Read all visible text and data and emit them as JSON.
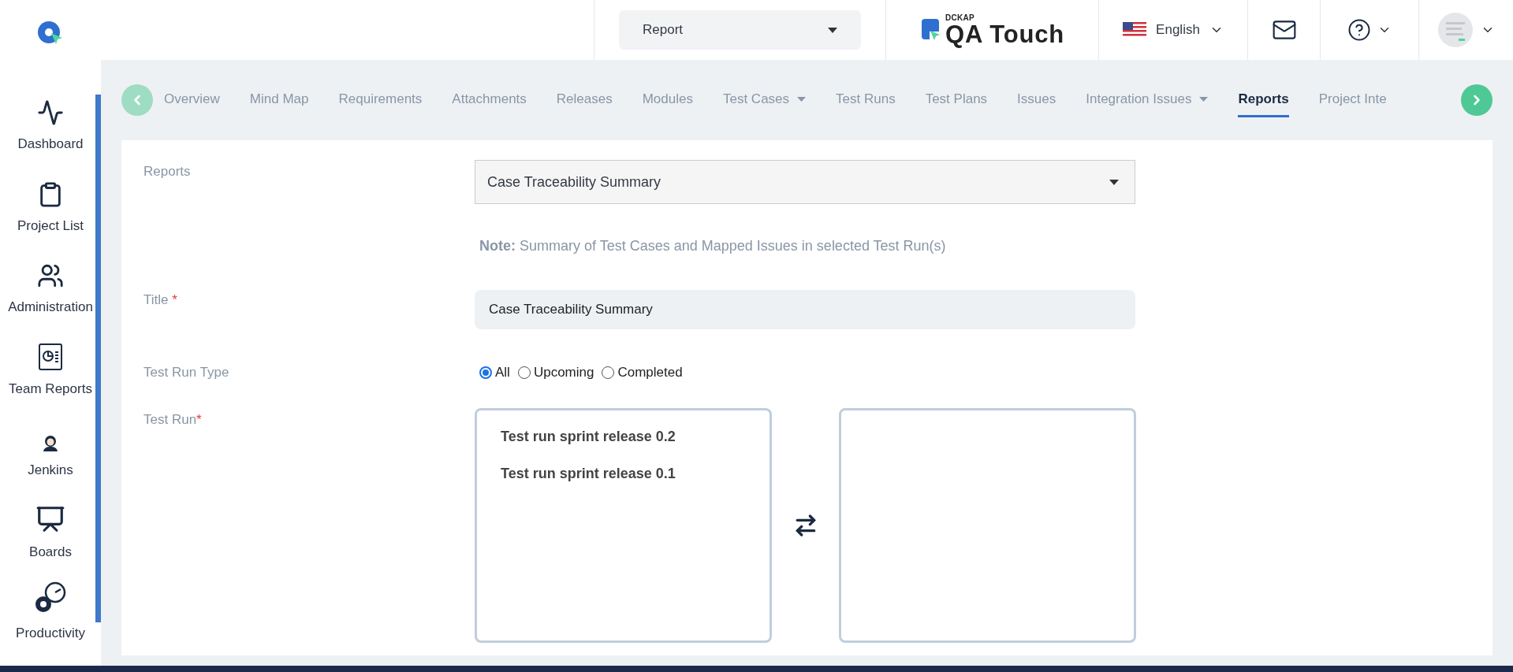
{
  "header": {
    "project_select": {
      "value": "Report"
    },
    "brand": {
      "maker": "DCKAP",
      "name": "QA Touch"
    },
    "language": "English"
  },
  "sidebar": {
    "items": [
      {
        "label": "Dashboard"
      },
      {
        "label": "Project List"
      },
      {
        "label": "Administration"
      },
      {
        "label": "Team Reports"
      },
      {
        "label": "Jenkins"
      },
      {
        "label": "Boards"
      },
      {
        "label": "Productivity"
      }
    ]
  },
  "tabs": [
    {
      "label": "Overview",
      "selected": false,
      "dropdown": false
    },
    {
      "label": "Mind Map",
      "selected": false,
      "dropdown": false
    },
    {
      "label": "Requirements",
      "selected": false,
      "dropdown": false
    },
    {
      "label": "Attachments",
      "selected": false,
      "dropdown": false
    },
    {
      "label": "Releases",
      "selected": false,
      "dropdown": false
    },
    {
      "label": "Modules",
      "selected": false,
      "dropdown": false
    },
    {
      "label": "Test Cases",
      "selected": false,
      "dropdown": true
    },
    {
      "label": "Test Runs",
      "selected": false,
      "dropdown": false
    },
    {
      "label": "Test Plans",
      "selected": false,
      "dropdown": false
    },
    {
      "label": "Issues",
      "selected": false,
      "dropdown": false
    },
    {
      "label": "Integration Issues",
      "selected": false,
      "dropdown": true
    },
    {
      "label": "Reports",
      "selected": true,
      "dropdown": false
    },
    {
      "label": "Project Inte",
      "selected": false,
      "dropdown": false
    }
  ],
  "form": {
    "reports": {
      "label": "Reports",
      "value": "Case Traceability Summary"
    },
    "note": {
      "label": "Note:",
      "text": "Summary of Test Cases and Mapped Issues in selected Test Run(s)"
    },
    "title": {
      "label": "Title",
      "required_mark": "*",
      "value": "Case Traceability Summary"
    },
    "run_type": {
      "label": "Test Run Type",
      "options": [
        {
          "label": "All",
          "selected": true
        },
        {
          "label": "Upcoming",
          "selected": false
        },
        {
          "label": "Completed",
          "selected": false
        }
      ]
    },
    "test_run": {
      "label": "Test Run",
      "required_mark": "*",
      "available": [
        "Test run sprint release 0.2",
        "Test run sprint release 0.1"
      ]
    }
  }
}
